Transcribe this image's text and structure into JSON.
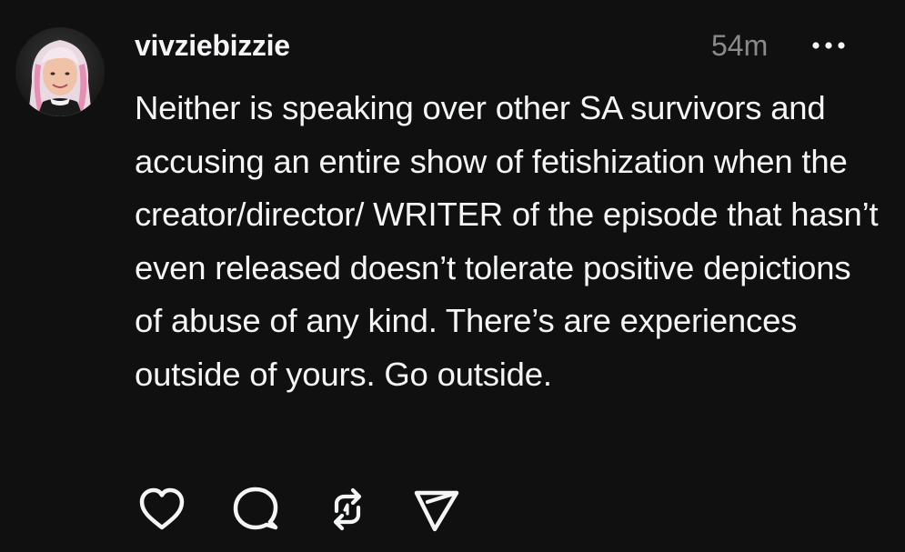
{
  "post": {
    "username": "vivziebizzie",
    "timestamp": "54m",
    "text": "Neither is speaking over other SA survivors and accusing an entire show of fetishization when the creator/director/ WRITER of the episode that hasn’t even released doesn’t tolerate positive depictions of abuse of any kind. There’s are experiences outside of yours. Go outside.",
    "avatar": "profile-photo",
    "more_icon": "ellipsis-icon"
  },
  "actions": {
    "icons": [
      "heart-icon",
      "comment-icon",
      "repost-icon",
      "share-icon"
    ]
  },
  "colors": {
    "background": "#101010",
    "text": "#f3f5f7",
    "muted": "#8a8a8a"
  }
}
